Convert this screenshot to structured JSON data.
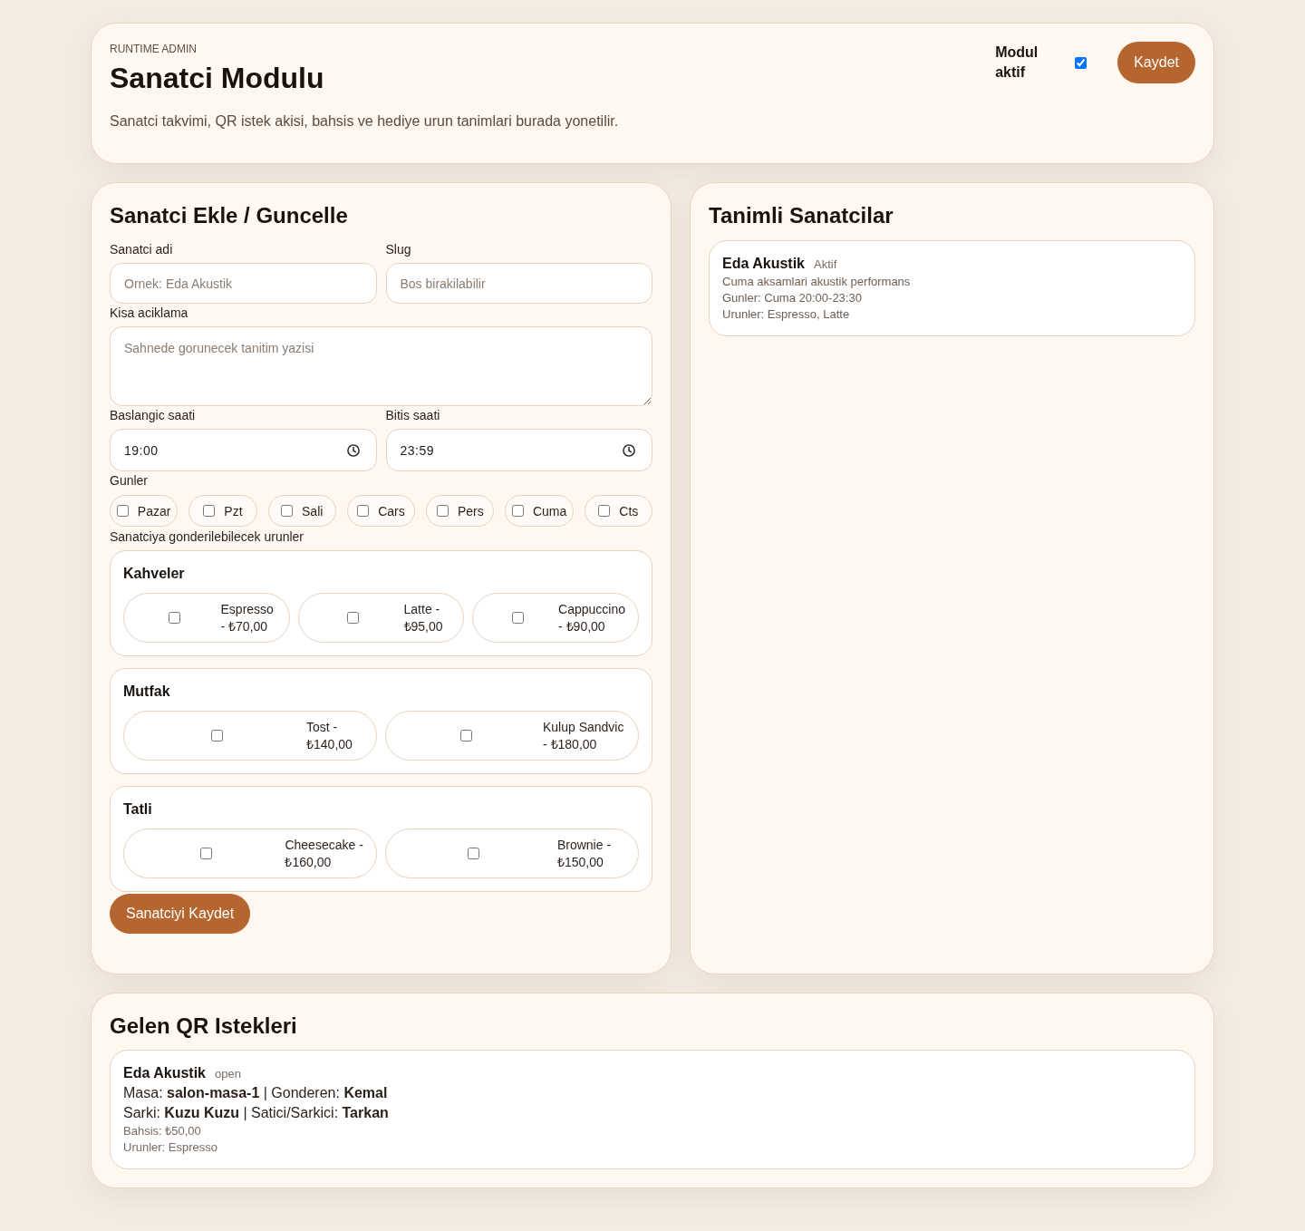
{
  "header": {
    "eyebrow": "RUNTIME ADMIN",
    "title": "Sanatci Modulu",
    "description": "Sanatci takvimi, QR istek akisi, bahsis ve hediye urun tanimlari burada yonetilir.",
    "module_toggle": {
      "label": "Modul aktif",
      "checked": true
    },
    "save_button": "Kaydet"
  },
  "artist_form": {
    "title": "Sanatci Ekle / Guncelle",
    "fields": [
      {
        "kind": "text",
        "label": "Sanatci adi",
        "placeholder": "Ornek: Eda Akustik"
      },
      {
        "kind": "text",
        "label": "Slug",
        "placeholder": "Bos birakilabilir"
      },
      {
        "kind": "textarea",
        "label": "Kisa aciklama",
        "placeholder": "Sahnede gorunecek tanitim yazisi"
      },
      {
        "kind": "time",
        "label": "Baslangic saati",
        "value": "19:00"
      },
      {
        "kind": "time",
        "label": "Bitis saati",
        "value": "23:59"
      }
    ],
    "days": {
      "label": "Gunler",
      "items": [
        {
          "label": "Pazar",
          "checked": false
        },
        {
          "label": "Pzt",
          "checked": false
        },
        {
          "label": "Sali",
          "checked": false
        },
        {
          "label": "Cars",
          "checked": false
        },
        {
          "label": "Pers",
          "checked": false
        },
        {
          "label": "Cuma",
          "checked": false
        },
        {
          "label": "Cts",
          "checked": false
        }
      ]
    },
    "products": {
      "label": "Sanatciya gonderilebilecek urunler",
      "groups": [
        {
          "title": "Kahveler",
          "items": [
            {
              "label": "Espresso - ₺70,00",
              "checked": false
            },
            {
              "label": "Latte - ₺95,00",
              "checked": false
            },
            {
              "label": "Cappuccino - ₺90,00",
              "checked": false
            }
          ]
        },
        {
          "title": "Mutfak",
          "items": [
            {
              "label": "Tost - ₺140,00",
              "checked": false
            },
            {
              "label": "Kulup Sandvic - ₺180,00",
              "checked": false
            }
          ]
        },
        {
          "title": "Tatli",
          "items": [
            {
              "label": "Cheesecake - ₺160,00",
              "checked": false
            },
            {
              "label": "Brownie - ₺150,00",
              "checked": false
            }
          ]
        }
      ]
    },
    "submit_button": "Sanatciyi Kaydet"
  },
  "artists_panel": {
    "title": "Tanimli Sanatcilar",
    "artists": [
      {
        "name": "Eda Akustik",
        "status": "Aktif",
        "lines": [
          "Cuma aksamlari akustik performans",
          "Gunler: Cuma 20:00-23:30",
          "Urunler: Espresso, Latte"
        ]
      }
    ]
  },
  "requests_panel": {
    "title": "Gelen QR Istekleri",
    "requests": [
      {
        "artist": "Eda Akustik",
        "status": "open",
        "details": [
          "Masa: **salon-masa-1** | Gonderen: **Kemal**",
          "Sarki: **Kuzu Kuzu** | Satici/Sarkici: **Tarkan**"
        ],
        "meta": [
          "Bahsis: ₺50,00",
          "Urunler: Espresso"
        ]
      }
    ]
  }
}
